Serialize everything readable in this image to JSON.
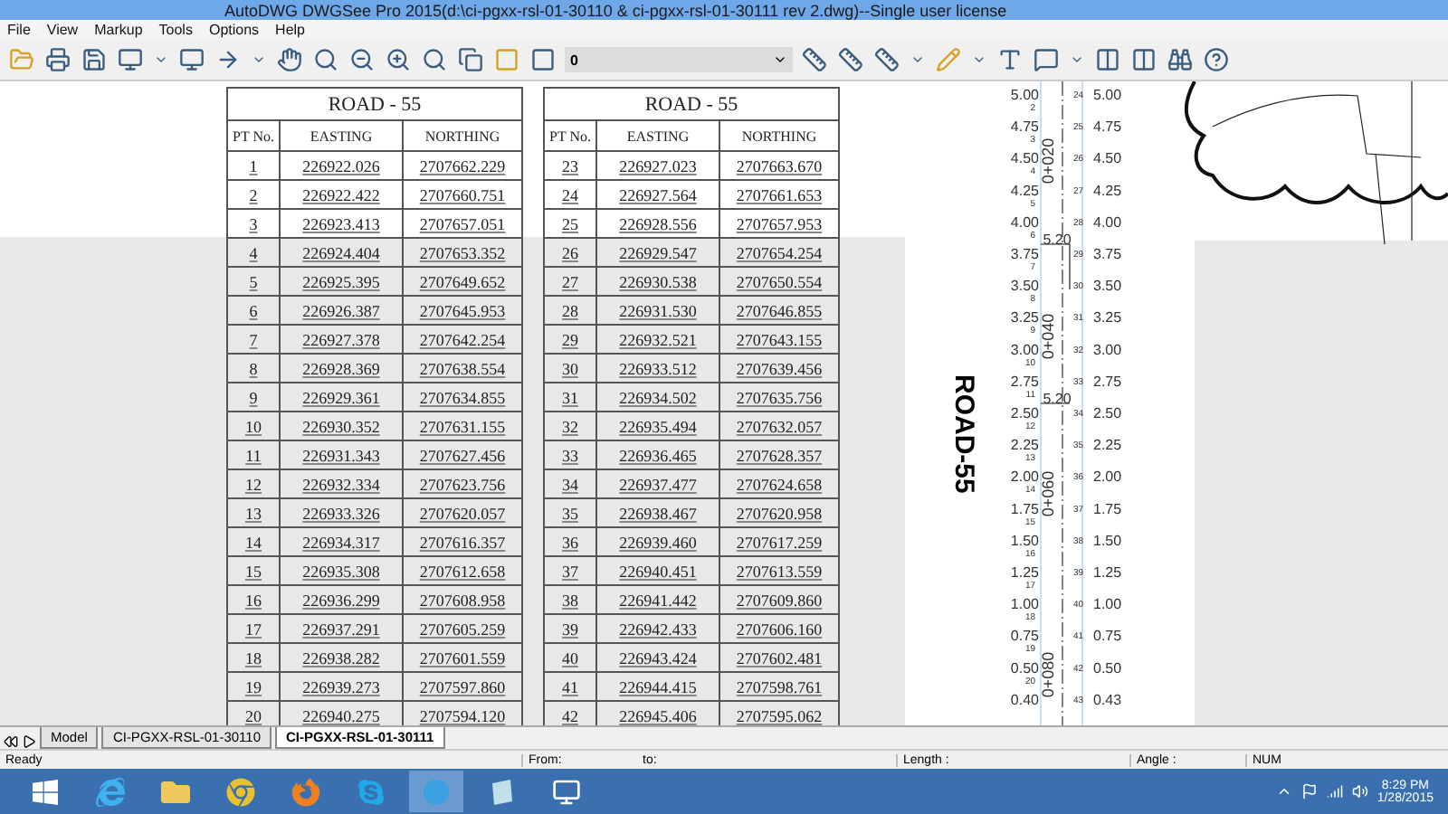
{
  "window": {
    "title": "AutoDWG DWGSee Pro 2015(d:\\ci-pgxx-rsl-01-30110 & ci-pgxx-rsl-01-30111 rev 2.dwg)--Single user license"
  },
  "menu": [
    "File",
    "View",
    "Markup",
    "Tools",
    "Options",
    "Help"
  ],
  "toolbar": {
    "layer_value": "0"
  },
  "tables": [
    {
      "title": "ROAD  -  55",
      "columns": [
        "PT No.",
        "EASTING",
        "NORTHING"
      ],
      "rows": [
        [
          "1",
          "226922.026",
          "2707662.229"
        ],
        [
          "2",
          "226922.422",
          "2707660.751"
        ],
        [
          "3",
          "226923.413",
          "2707657.051"
        ],
        [
          "4",
          "226924.404",
          "2707653.352"
        ],
        [
          "5",
          "226925.395",
          "2707649.652"
        ],
        [
          "6",
          "226926.387",
          "2707645.953"
        ],
        [
          "7",
          "226927.378",
          "2707642.254"
        ],
        [
          "8",
          "226928.369",
          "2707638.554"
        ],
        [
          "9",
          "226929.361",
          "2707634.855"
        ],
        [
          "10",
          "226930.352",
          "2707631.155"
        ],
        [
          "11",
          "226931.343",
          "2707627.456"
        ],
        [
          "12",
          "226932.334",
          "2707623.756"
        ],
        [
          "13",
          "226933.326",
          "2707620.057"
        ],
        [
          "14",
          "226934.317",
          "2707616.357"
        ],
        [
          "15",
          "226935.308",
          "2707612.658"
        ],
        [
          "16",
          "226936.299",
          "2707608.958"
        ],
        [
          "17",
          "226937.291",
          "2707605.259"
        ],
        [
          "18",
          "226938.282",
          "2707601.559"
        ],
        [
          "19",
          "226939.273",
          "2707597.860"
        ],
        [
          "20",
          "226940.275",
          "2707594.120"
        ]
      ]
    },
    {
      "title": "ROAD  -  55",
      "columns": [
        "PT No.",
        "EASTING",
        "NORTHING"
      ],
      "rows": [
        [
          "23",
          "226927.023",
          "2707663.670"
        ],
        [
          "24",
          "226927.564",
          "2707661.653"
        ],
        [
          "25",
          "226928.556",
          "2707657.953"
        ],
        [
          "26",
          "226929.547",
          "2707654.254"
        ],
        [
          "27",
          "226930.538",
          "2707650.554"
        ],
        [
          "28",
          "226931.530",
          "2707646.855"
        ],
        [
          "29",
          "226932.521",
          "2707643.155"
        ],
        [
          "30",
          "226933.512",
          "2707639.456"
        ],
        [
          "31",
          "226934.502",
          "2707635.756"
        ],
        [
          "32",
          "226935.494",
          "2707632.057"
        ],
        [
          "33",
          "226936.465",
          "2707628.357"
        ],
        [
          "34",
          "226937.477",
          "2707624.658"
        ],
        [
          "35",
          "226938.467",
          "2707620.958"
        ],
        [
          "36",
          "226939.460",
          "2707617.259"
        ],
        [
          "37",
          "226940.451",
          "2707613.559"
        ],
        [
          "38",
          "226941.442",
          "2707609.860"
        ],
        [
          "39",
          "226942.433",
          "2707606.160"
        ],
        [
          "40",
          "226943.424",
          "2707602.481"
        ],
        [
          "41",
          "226944.415",
          "2707598.761"
        ],
        [
          "42",
          "226945.406",
          "2707595.062"
        ]
      ]
    }
  ],
  "drawing": {
    "label": "ROAD-55",
    "left_levels": [
      "5.00",
      "4.75",
      "4.50",
      "4.25",
      "4.00",
      "3.75",
      "3.50",
      "3.25",
      "3.00",
      "2.75",
      "2.50",
      "2.25",
      "2.00",
      "1.75",
      "1.50",
      "1.25",
      "1.00",
      "0.75",
      "0.50",
      "0.40"
    ],
    "left_points": [
      "2",
      "3",
      "4",
      "5",
      "6",
      "7",
      "8",
      "9",
      "10",
      "11",
      "12",
      "13",
      "14",
      "15",
      "16",
      "17",
      "18",
      "19",
      "20"
    ],
    "right_levels": [
      "5.00",
      "4.75",
      "4.50",
      "4.25",
      "4.00",
      "3.75",
      "3.50",
      "3.25",
      "3.00",
      "2.75",
      "2.50",
      "2.25",
      "2.00",
      "1.75",
      "1.50",
      "1.25",
      "1.00",
      "0.75",
      "0.50",
      "0.43"
    ],
    "right_points": [
      "24",
      "25",
      "26",
      "27",
      "28",
      "29",
      "30",
      "31",
      "32",
      "33",
      "34",
      "35",
      "36",
      "37",
      "38",
      "39",
      "40",
      "41",
      "42",
      "43"
    ],
    "chainages": [
      "0+020",
      "0+040",
      "0+060",
      "0+080"
    ],
    "widths": [
      "5.20",
      "5.20"
    ]
  },
  "sheet_tabs": [
    {
      "label": "Model",
      "selected": false
    },
    {
      "label": "CI-PGXX-RSL-01-30110",
      "selected": false
    },
    {
      "label": "CI-PGXX-RSL-01-30111",
      "selected": true
    }
  ],
  "status_bar": {
    "state": "Ready",
    "from": "From:",
    "to": "to:",
    "length": "Length :",
    "angle": "Angle :",
    "num": "NUM"
  },
  "taskbar": {
    "time": "8:29 PM",
    "date": "1/28/2015"
  }
}
